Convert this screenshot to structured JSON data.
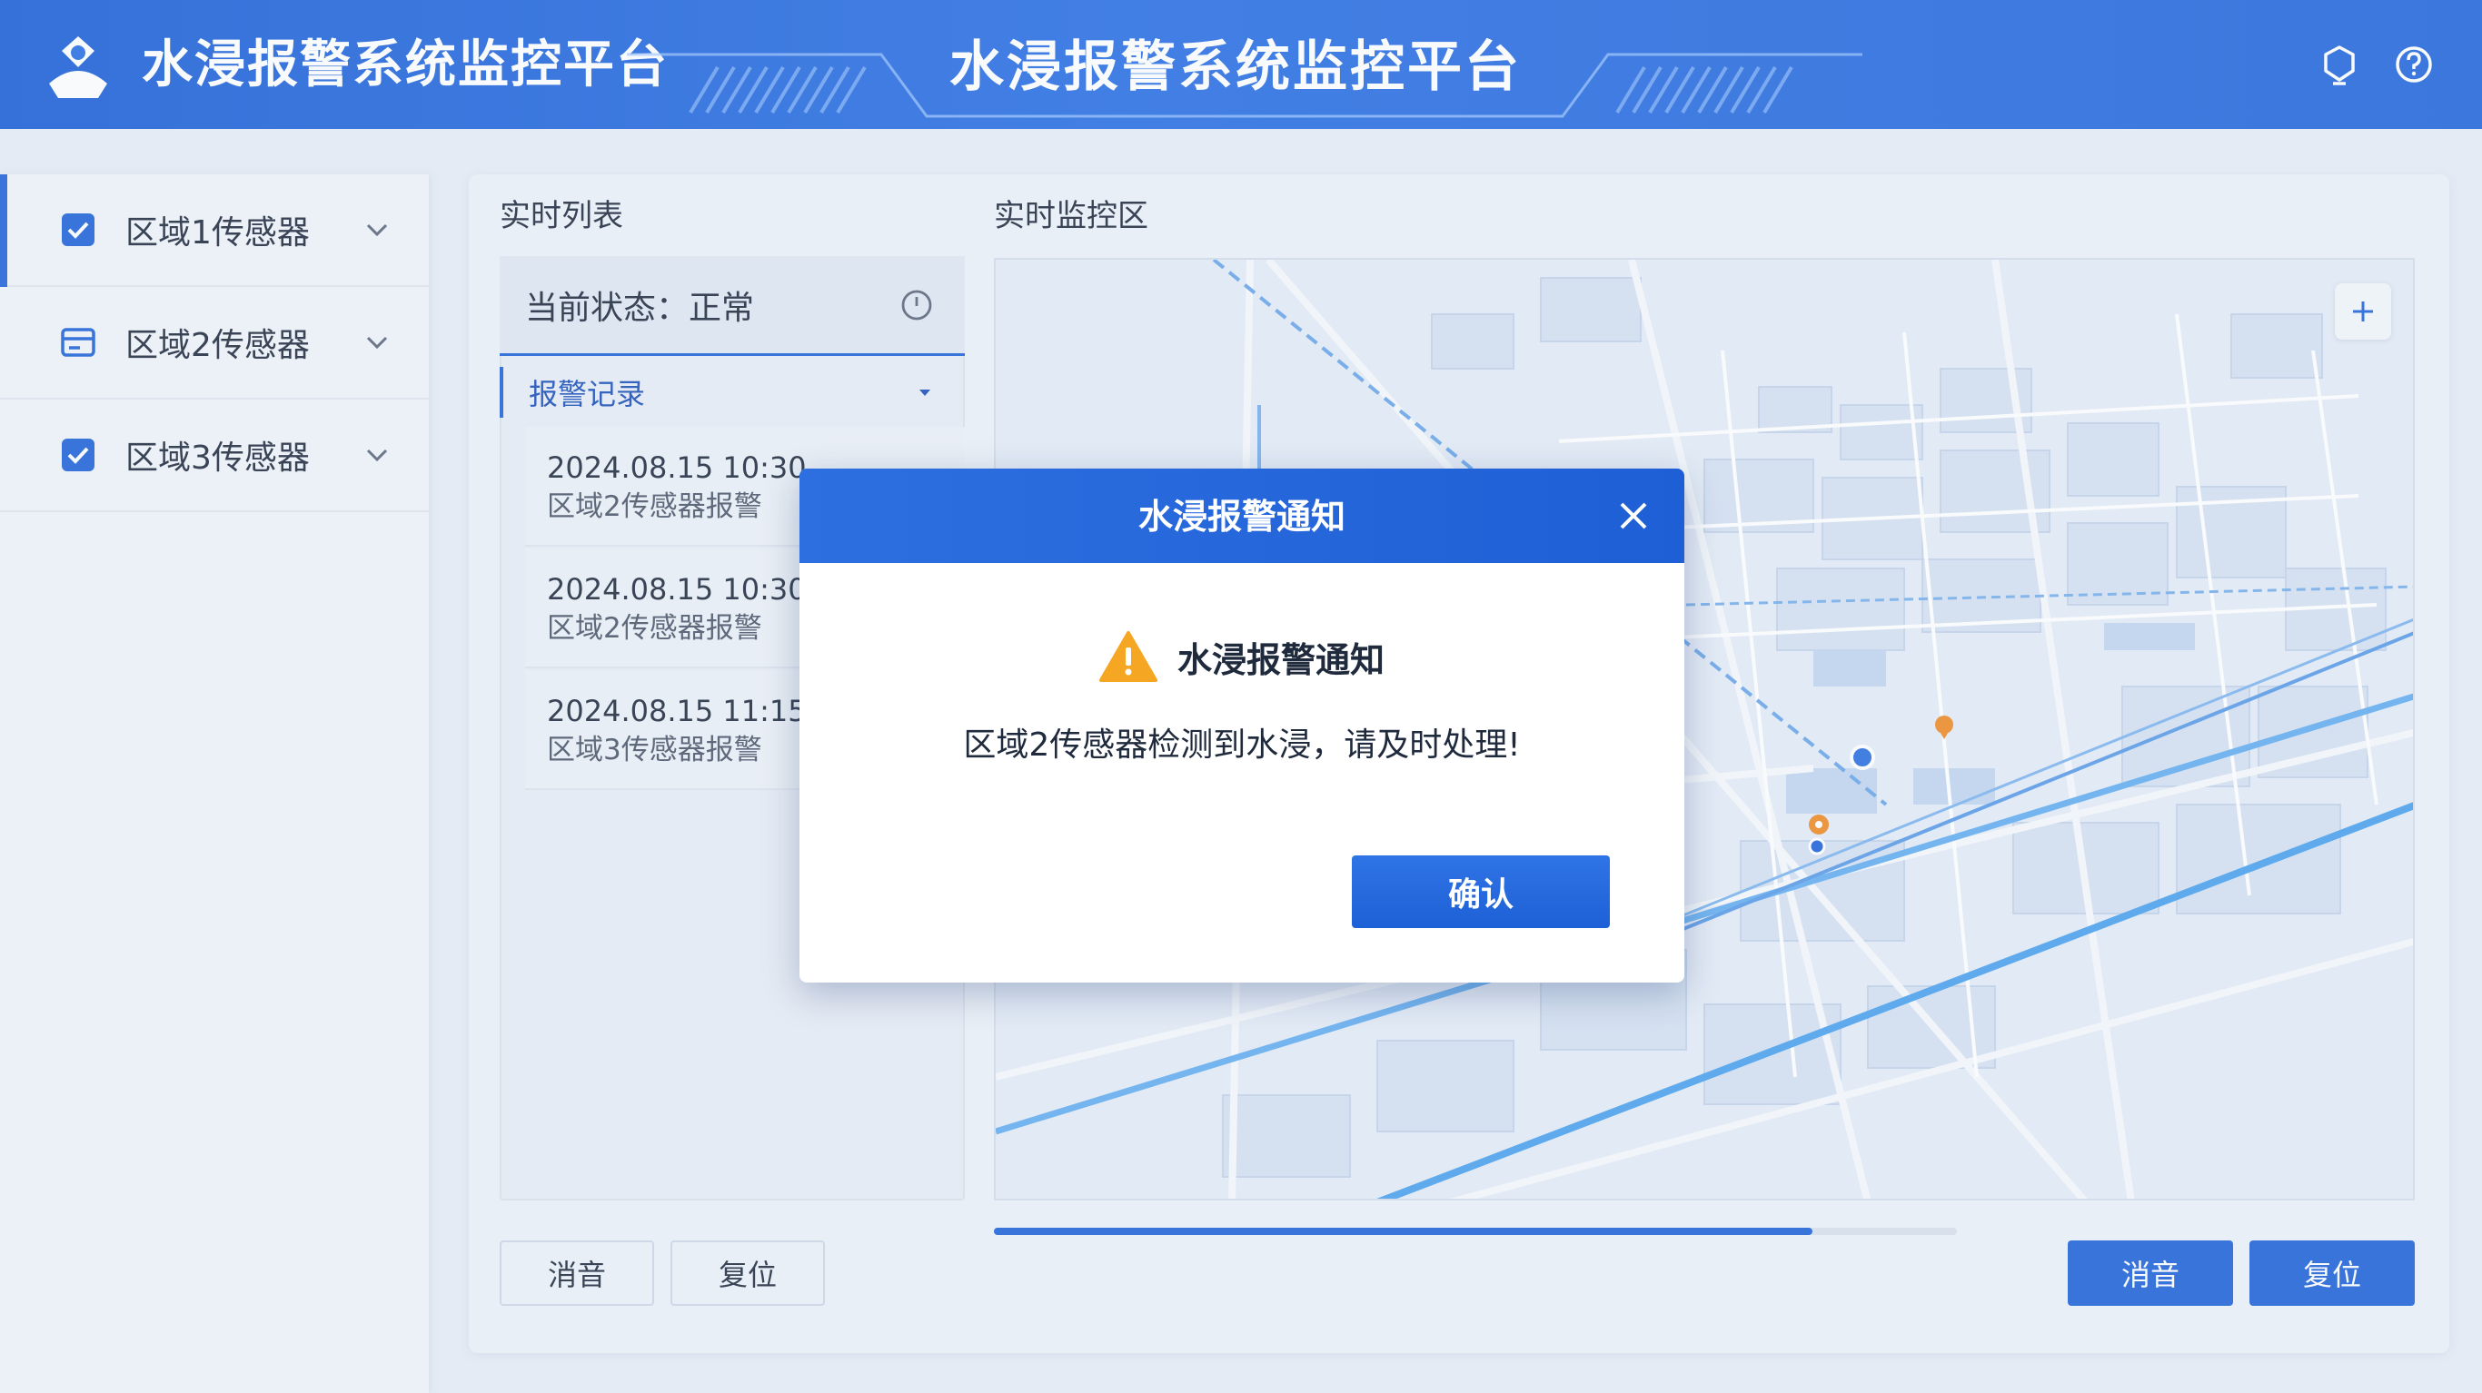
{
  "header": {
    "brand": "水浸报警系统监控平台",
    "center_title": "水浸报警系统监控平台",
    "icons": [
      "bell-icon",
      "help-icon"
    ]
  },
  "sidebar": {
    "items": [
      {
        "label": "区域1传感器",
        "icon": "checkbox-checked-icon",
        "active": true
      },
      {
        "label": "区域2传感器",
        "icon": "card-icon",
        "active": false
      },
      {
        "label": "区域3传感器",
        "icon": "checkbox-checked-icon",
        "active": false
      }
    ]
  },
  "list": {
    "title": "实时列表",
    "status": "当前状态：正常",
    "records_header": "报警记录",
    "records": [
      {
        "time": "2024.08.15 10:30",
        "desc": "区域2传感器报警"
      },
      {
        "time": "2024.08.15 10:30",
        "desc": "区域2传感器报警"
      },
      {
        "time": "2024.08.15 11:15",
        "desc": "区域3传感器报警"
      }
    ],
    "mute_label": "消音",
    "reset_label": "复位"
  },
  "monitor": {
    "title": "实时监控区",
    "zoom_label": "+",
    "progress": 0.85,
    "mute_label": "消音",
    "reset_label": "复位"
  },
  "modal": {
    "title": "水浸报警通知",
    "heading": "水浸报警通知",
    "message": "区域2传感器检测到水浸，请及时处理!",
    "confirm_label": "确认"
  },
  "colors": {
    "primary": "#1f62d9",
    "warning": "#f5a623",
    "marker_orange": "#f08a24"
  }
}
